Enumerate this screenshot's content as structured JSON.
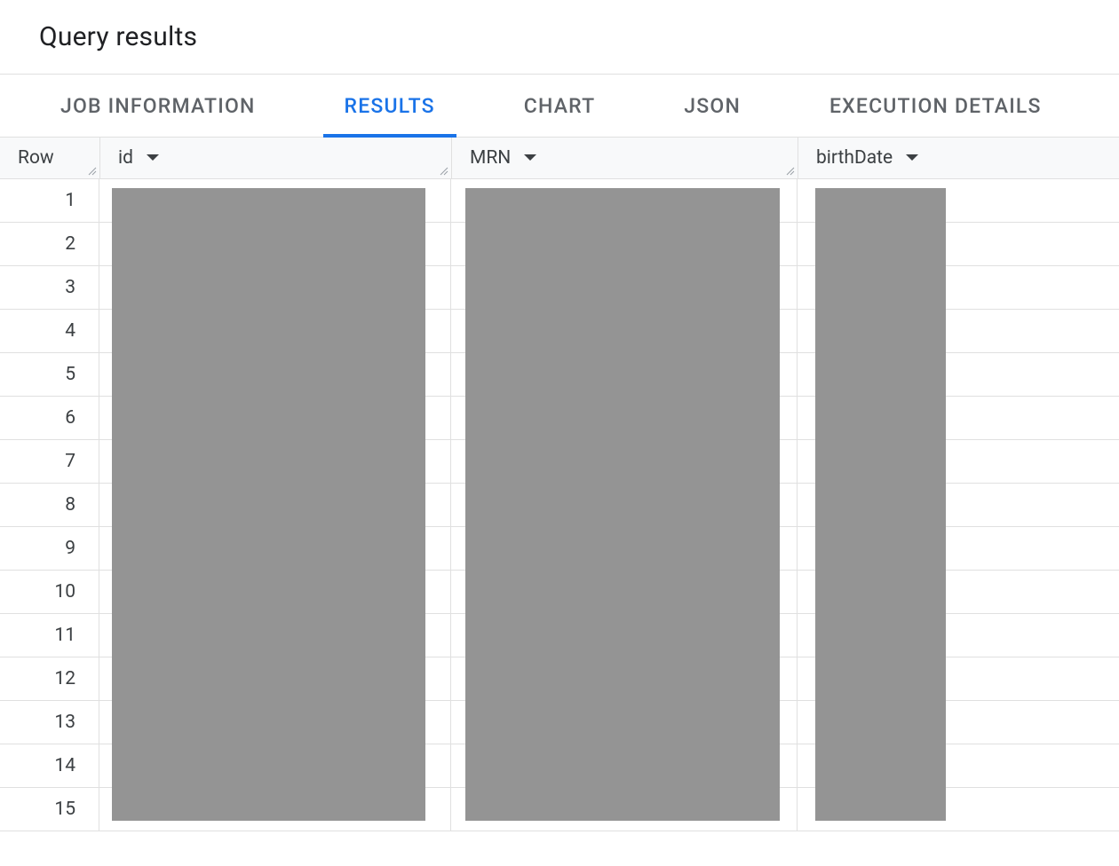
{
  "header": {
    "title": "Query results"
  },
  "tabs": {
    "items": [
      {
        "label": "JOB INFORMATION",
        "active": false
      },
      {
        "label": "RESULTS",
        "active": true
      },
      {
        "label": "CHART",
        "active": false
      },
      {
        "label": "JSON",
        "active": false
      },
      {
        "label": "EXECUTION DETAILS",
        "active": false
      }
    ]
  },
  "table": {
    "columns": [
      {
        "key": "row",
        "label": "Row",
        "sortable": false,
        "resizable": true
      },
      {
        "key": "id",
        "label": "id",
        "sortable": true,
        "resizable": true
      },
      {
        "key": "mrn",
        "label": "MRN",
        "sortable": true,
        "resizable": true
      },
      {
        "key": "birthDate",
        "label": "birthDate",
        "sortable": true,
        "resizable": false
      }
    ],
    "rows": [
      {
        "row": "1"
      },
      {
        "row": "2"
      },
      {
        "row": "3"
      },
      {
        "row": "4"
      },
      {
        "row": "5"
      },
      {
        "row": "6"
      },
      {
        "row": "7"
      },
      {
        "row": "8"
      },
      {
        "row": "9"
      },
      {
        "row": "10"
      },
      {
        "row": "11"
      },
      {
        "row": "12"
      },
      {
        "row": "13"
      },
      {
        "row": "14"
      },
      {
        "row": "15"
      }
    ],
    "redacted_columns": [
      "id",
      "mrn",
      "birthDate"
    ]
  }
}
